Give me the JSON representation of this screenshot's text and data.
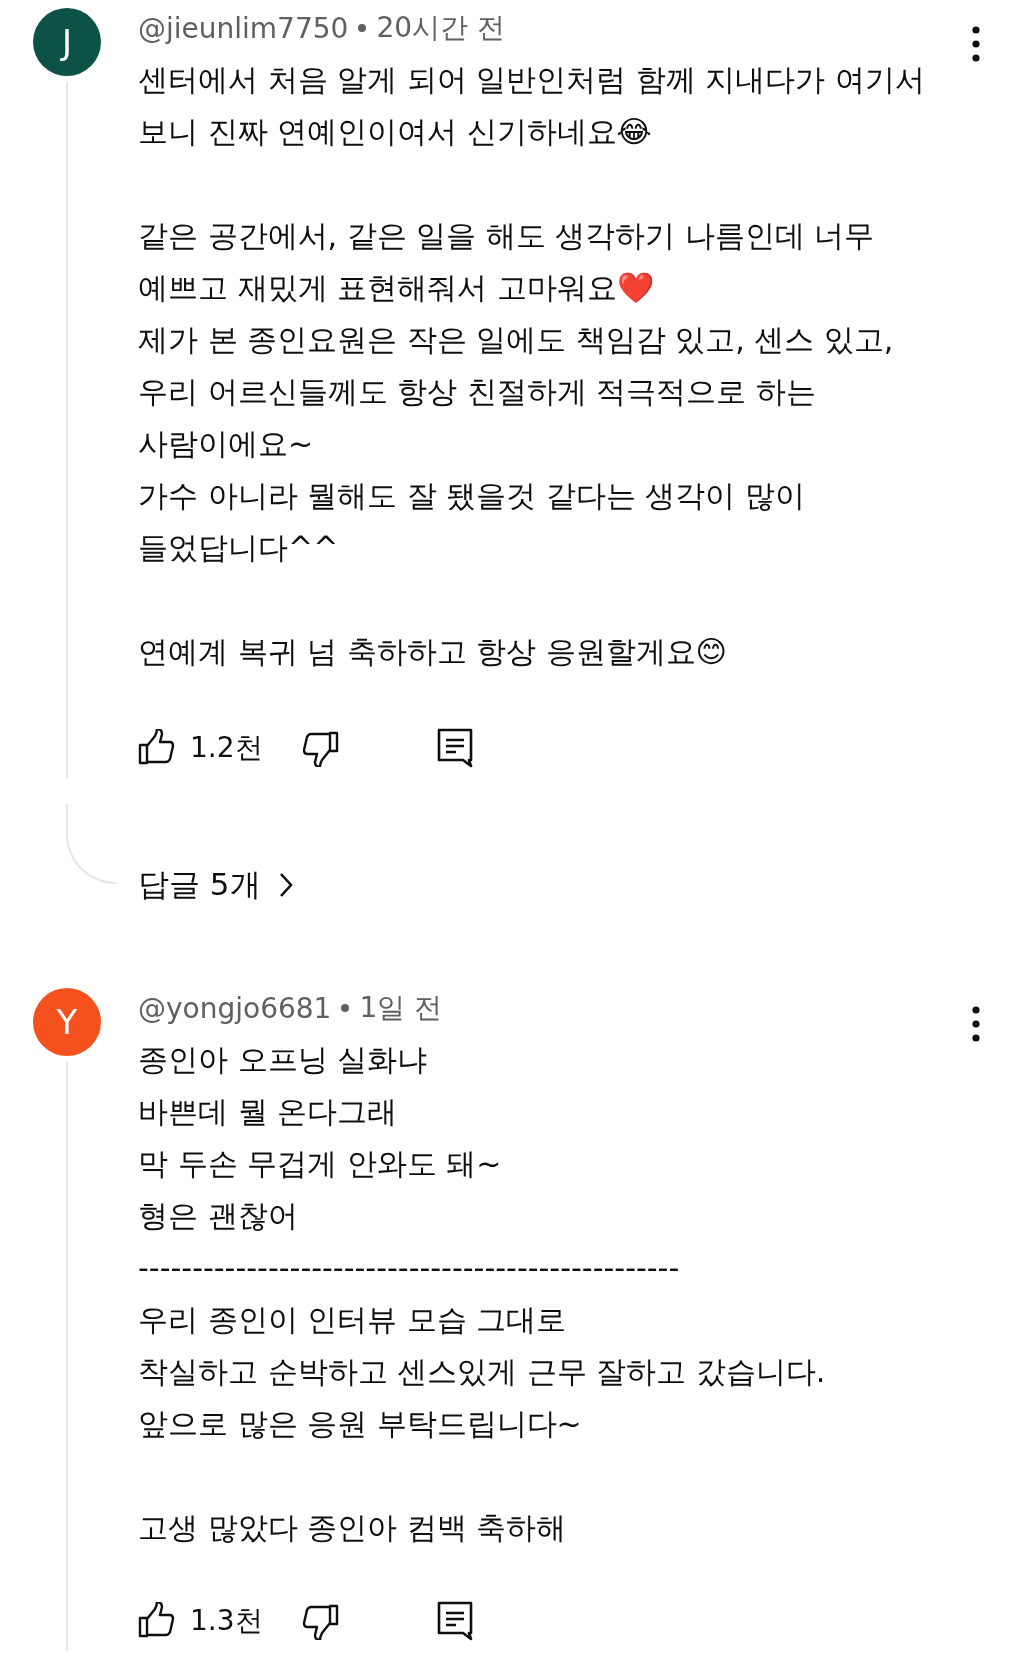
{
  "comments": [
    {
      "avatar": {
        "letter": "J",
        "color": "#0d5246"
      },
      "author": "@jieunlim7750",
      "time": "20시간 전",
      "paragraphs": [
        [
          "센터에서 처음 알게 되어 일반인처럼 함께 지내다가 여기서",
          "보니 진짜 연예인이여서 신기하네요😂"
        ],
        [
          "같은 공간에서, 같은 일을 해도 생각하기 나름인데 너무",
          "예쁘고 재밌게 표현해줘서 고마워요❤️",
          "제가 본 종인요원은 작은 일에도 책임감 있고, 센스 있고,",
          "우리 어르신들께도 항상 친절하게 적극적으로 하는",
          "사람이에요~",
          "가수 아니라 뭘해도 잘 됐을것 같다는 생각이 많이",
          "들었답니다^^"
        ],
        [
          "연예계 복귀 넘 축하하고 항상 응원할게요😊"
        ]
      ],
      "likes": "1.2천",
      "replies": "답글 5개"
    },
    {
      "avatar": {
        "letter": "Y",
        "color": "#f4511e"
      },
      "author": "@yongjo6681",
      "time": "1일 전",
      "paragraphs": [
        [
          "종인아 오프닝 실화냐",
          "바쁜데 뭘 온다그래",
          "막 두손 무겁게 안와도 돼~",
          "형은 괜찮어",
          "--------------------------------------------------",
          "우리 종인이 인터뷰 모습 그대로",
          "착실하고 순박하고 센스있게 근무 잘하고 갔습니다.",
          "앞으로 많은 응원 부탁드립니다~"
        ],
        [
          "고생 많았다 종인아 컴백 축하해"
        ]
      ],
      "likes": "1.3천"
    }
  ]
}
